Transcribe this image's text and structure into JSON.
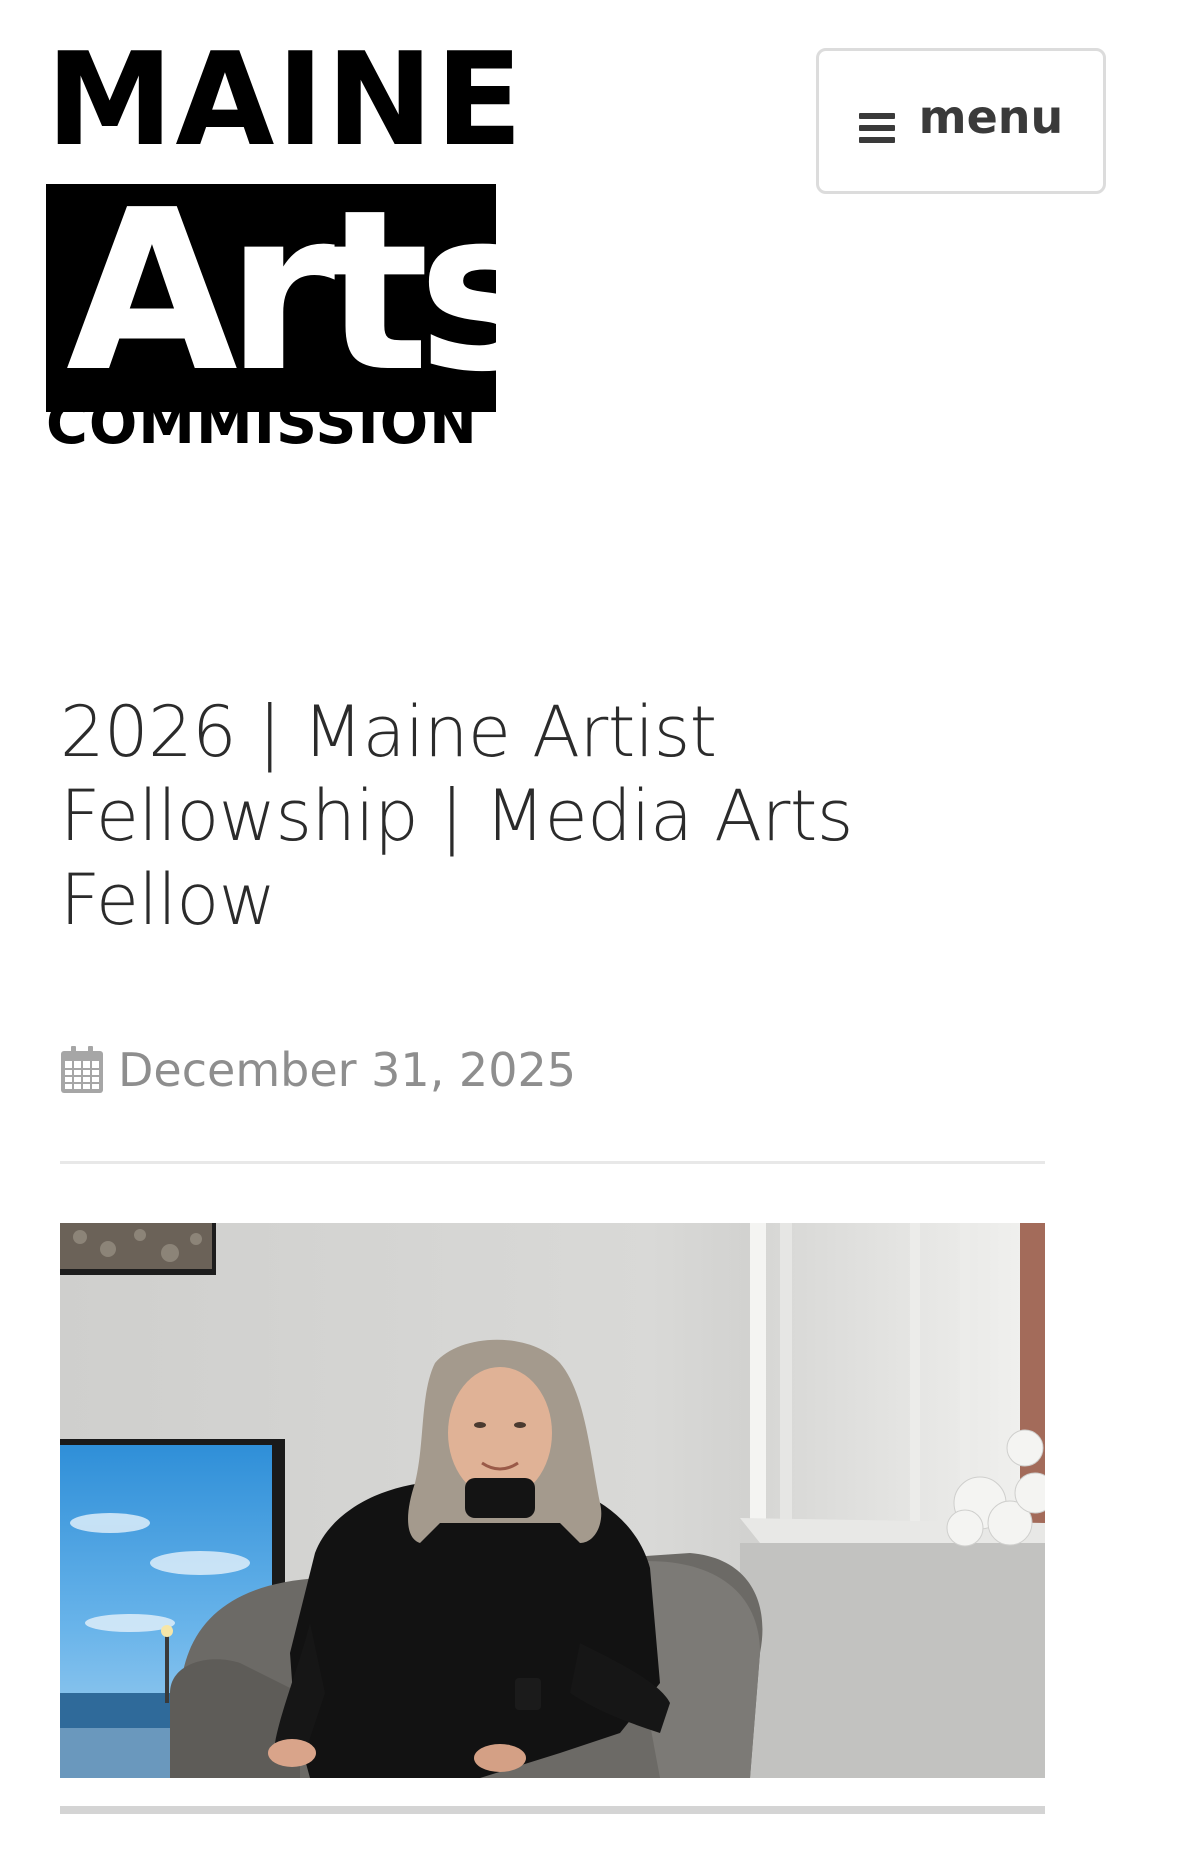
{
  "header": {
    "logo": {
      "line1": "MAINE",
      "line2": "Arts",
      "line3": "COMMISSION"
    },
    "menu_button": {
      "icon": "hamburger-icon",
      "label": "menu"
    }
  },
  "post": {
    "title": "2026 | Maine Artist Fellowship | Media Arts Fellow",
    "date_icon": "calendar-icon",
    "date": "December 31, 2025",
    "featured_image": "photo-woman-seated-in-armchair"
  },
  "colors": {
    "text": "#2b2b2b",
    "meta": "#8e8e8e",
    "divider": "#e8e8e8",
    "button_border": "#dcdcdc"
  }
}
